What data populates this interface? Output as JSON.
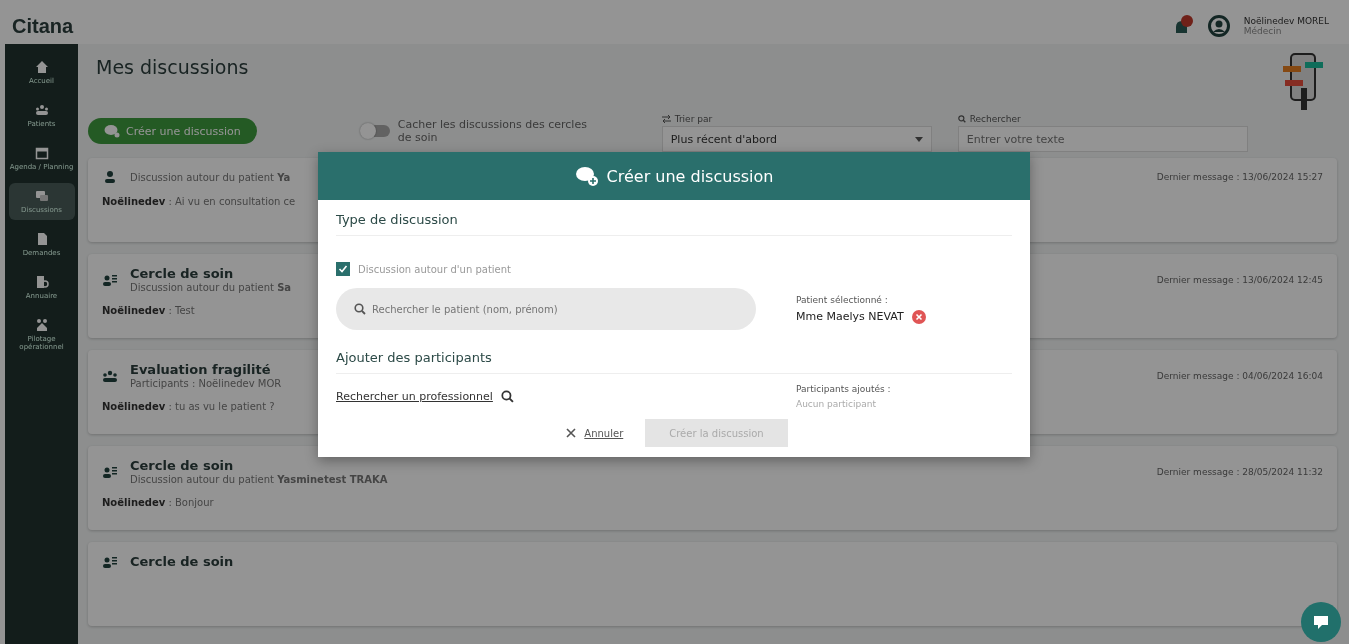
{
  "header": {
    "logo": "Citana",
    "user_name": "Noëlinedev MOREL",
    "user_role": "Médecin",
    "notifications": true
  },
  "sidebar": {
    "items": [
      {
        "label": "Accueil",
        "selected": false
      },
      {
        "label": "Patients",
        "selected": false
      },
      {
        "label": "Agenda / Planning",
        "selected": false
      },
      {
        "label": "Discussions",
        "selected": true
      },
      {
        "label": "Demandes",
        "selected": false
      },
      {
        "label": "Annuaire",
        "selected": false
      },
      {
        "label": "Pilotage opérationnel",
        "selected": false
      }
    ]
  },
  "page": {
    "title": "Mes discussions",
    "create_button": "Créer une discussion",
    "toggle": {
      "label": "Cacher les discussions des cercles de soin",
      "on": false
    },
    "sort": {
      "label": "Trier par",
      "value": "Plus récent d'abord"
    },
    "search": {
      "label": "Rechercher",
      "placeholder": "Entrer votre texte"
    }
  },
  "discussions": [
    {
      "kind": "patient",
      "subtitle": "Discussion autour du patient **Ya**",
      "message": "**Noëlinedev** : Ai vu en consultation ce",
      "date": "Dernier message : 13/06/2024 15:27"
    },
    {
      "kind": "circle",
      "title": "Cercle de soin",
      "subtitle": "Discussion autour du patient **Sa**",
      "message": "**Noëlinedev** : Test",
      "date": "Dernier message : 13/06/2024 12:45"
    },
    {
      "kind": "group",
      "title": "Evaluation fragilité",
      "subtitle": "Participants : Noëlinedev MOR",
      "message": "**Noëlinedev** : tu as vu le patient ?",
      "date": "Dernier message : 04/06/2024 16:04"
    },
    {
      "kind": "circle",
      "title": "Cercle de soin",
      "subtitle": "Discussion autour du patient **Yasminetest TRAKA**",
      "message": "**Noëlinedev** : Bonjour",
      "date": "Dernier message : 28/05/2024 11:32"
    },
    {
      "kind": "circle",
      "title": "Cercle de soin"
    }
  ],
  "modal": {
    "title": "Créer une discussion",
    "type_heading": "Type de discussion",
    "patient_checkbox": {
      "label": "Discussion autour d'un patient",
      "checked": true
    },
    "patient_search": {
      "placeholder": "Rechercher le patient (nom, prénom)"
    },
    "selected_label": "Patient sélectionné :",
    "selected_patient": "Mme Maelys NEVAT",
    "participants_heading": "Ajouter des participants",
    "pro_search_link": "Rechercher un professionnel",
    "added_label": "Participants ajoutés :",
    "added_value": "Aucun participant",
    "cancel": "Annuler",
    "submit": {
      "label": "Créer la discussion",
      "disabled": true
    }
  }
}
